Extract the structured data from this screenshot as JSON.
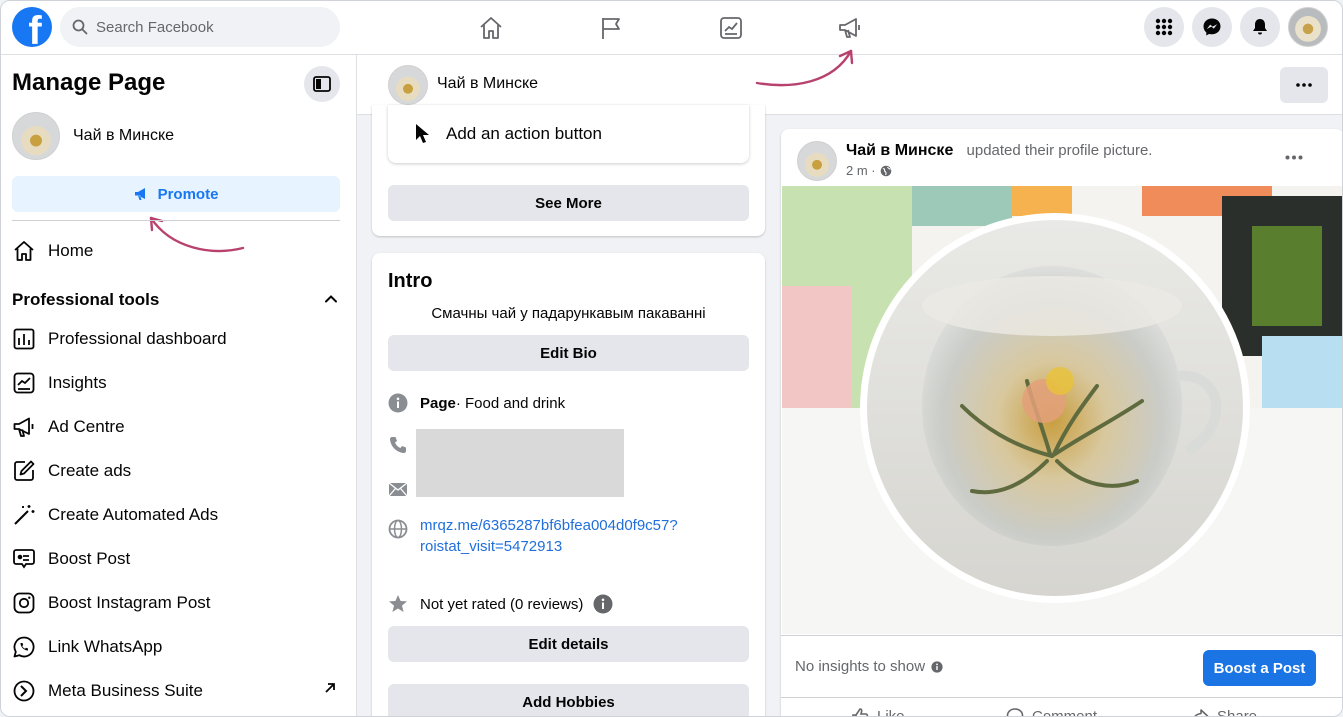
{
  "topbar": {
    "logo_letter": "f",
    "search_placeholder": "Search Facebook",
    "nav_icons": [
      "home-icon",
      "flag-icon",
      "insights-icon",
      "megaphone-icon"
    ],
    "right_icons": [
      "menu-grid-icon",
      "messenger-icon",
      "notifications-icon",
      "profile-avatar"
    ]
  },
  "sidebar": {
    "title": "Manage Page",
    "page_name": "Чай в Минске",
    "promote_label": "Promote",
    "home_label": "Home",
    "section_title": "Professional tools",
    "items": [
      {
        "label": "Professional dashboard",
        "icon": "dashboard-icon"
      },
      {
        "label": "Insights",
        "icon": "insights-icon"
      },
      {
        "label": "Ad Centre",
        "icon": "megaphone-icon"
      },
      {
        "label": "Create ads",
        "icon": "edit-icon"
      },
      {
        "label": "Create Automated Ads",
        "icon": "magic-wand-icon"
      },
      {
        "label": "Boost Post",
        "icon": "boost-icon"
      },
      {
        "label": "Boost Instagram Post",
        "icon": "instagram-icon"
      },
      {
        "label": "Link WhatsApp",
        "icon": "whatsapp-icon"
      },
      {
        "label": "Meta Business Suite",
        "icon": "meta-suite-icon"
      }
    ]
  },
  "page_header": {
    "name": "Чай в Минске"
  },
  "middle": {
    "action_button_label": "Add an action button",
    "see_more_label": "See More",
    "intro": {
      "title": "Intro",
      "bio": "Смачны чай у падарункавым пакаванні",
      "edit_bio_label": "Edit Bio",
      "page_label": "Page",
      "page_category": " · Food and drink",
      "link_line1": "mrqz.me/6365287bf6bfea004d0f9c57?",
      "link_line2": "roistat_visit=5472913",
      "rating": "Not yet rated (0 reviews)",
      "edit_details_label": "Edit details",
      "add_hobbies_label": "Add Hobbies"
    }
  },
  "post": {
    "author": "Чай в Минске",
    "action": "updated their profile picture.",
    "time": "2 m ·",
    "no_insights": "No insights to show",
    "boost_label": "Boost a Post",
    "reactions": [
      "Like",
      "Comment",
      "Share"
    ]
  },
  "colors": {
    "brand": "#1877f2",
    "promote_bg": "#e7f3ff",
    "annotation_arrow": "#b8416d"
  }
}
